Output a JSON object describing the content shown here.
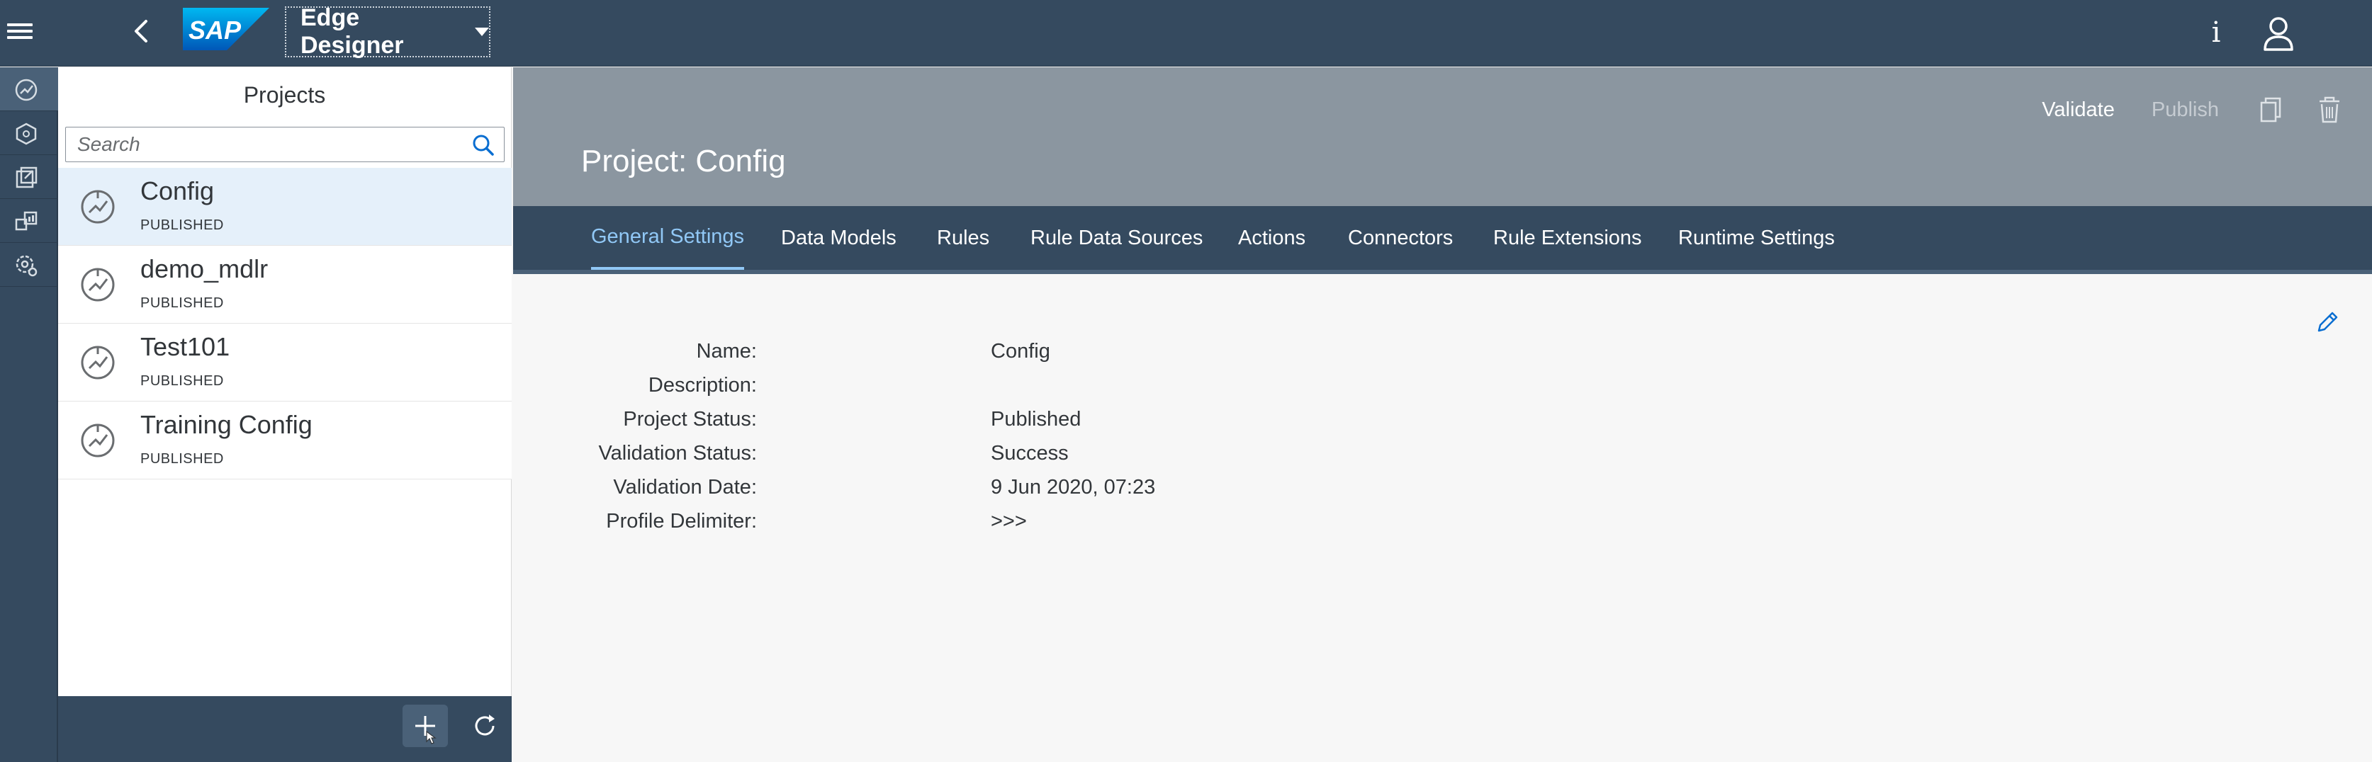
{
  "shell": {
    "logo_text": "SAP",
    "app_title": "Edge Designer",
    "info_glyph": "i",
    "colors": {
      "shell_bg": "#354a5f",
      "accent": "#91c8f6",
      "header_bg": "#8b96a0",
      "selected_row": "#e5f0fa"
    }
  },
  "rail": {
    "icons": [
      "projects-icon",
      "data-models-icon",
      "deploy-icon",
      "monitor-icon",
      "settings-icon"
    ]
  },
  "master": {
    "title": "Projects",
    "search_placeholder": "Search",
    "items": [
      {
        "name": "Config",
        "status": "PUBLISHED"
      },
      {
        "name": "demo_mdlr",
        "status": "PUBLISHED"
      },
      {
        "name": "Test101",
        "status": "PUBLISHED"
      },
      {
        "name": "Training Config",
        "status": "PUBLISHED"
      }
    ]
  },
  "detail": {
    "actions": {
      "validate": "Validate",
      "publish": "Publish"
    },
    "title": "Project: Config",
    "tabs": [
      "General Settings",
      "Data Models",
      "Rules",
      "Rule Data Sources",
      "Actions",
      "Connectors",
      "Rule Extensions",
      "Runtime Settings"
    ],
    "fields": [
      {
        "label": "Name:",
        "value": "Config"
      },
      {
        "label": "Description:",
        "value": ""
      },
      {
        "label": "Project Status:",
        "value": "Published"
      },
      {
        "label": "Validation Status:",
        "value": "Success"
      },
      {
        "label": "Validation Date:",
        "value": "9 Jun 2020, 07:23"
      },
      {
        "label": "Profile Delimiter:",
        "value": ">>>"
      }
    ]
  }
}
